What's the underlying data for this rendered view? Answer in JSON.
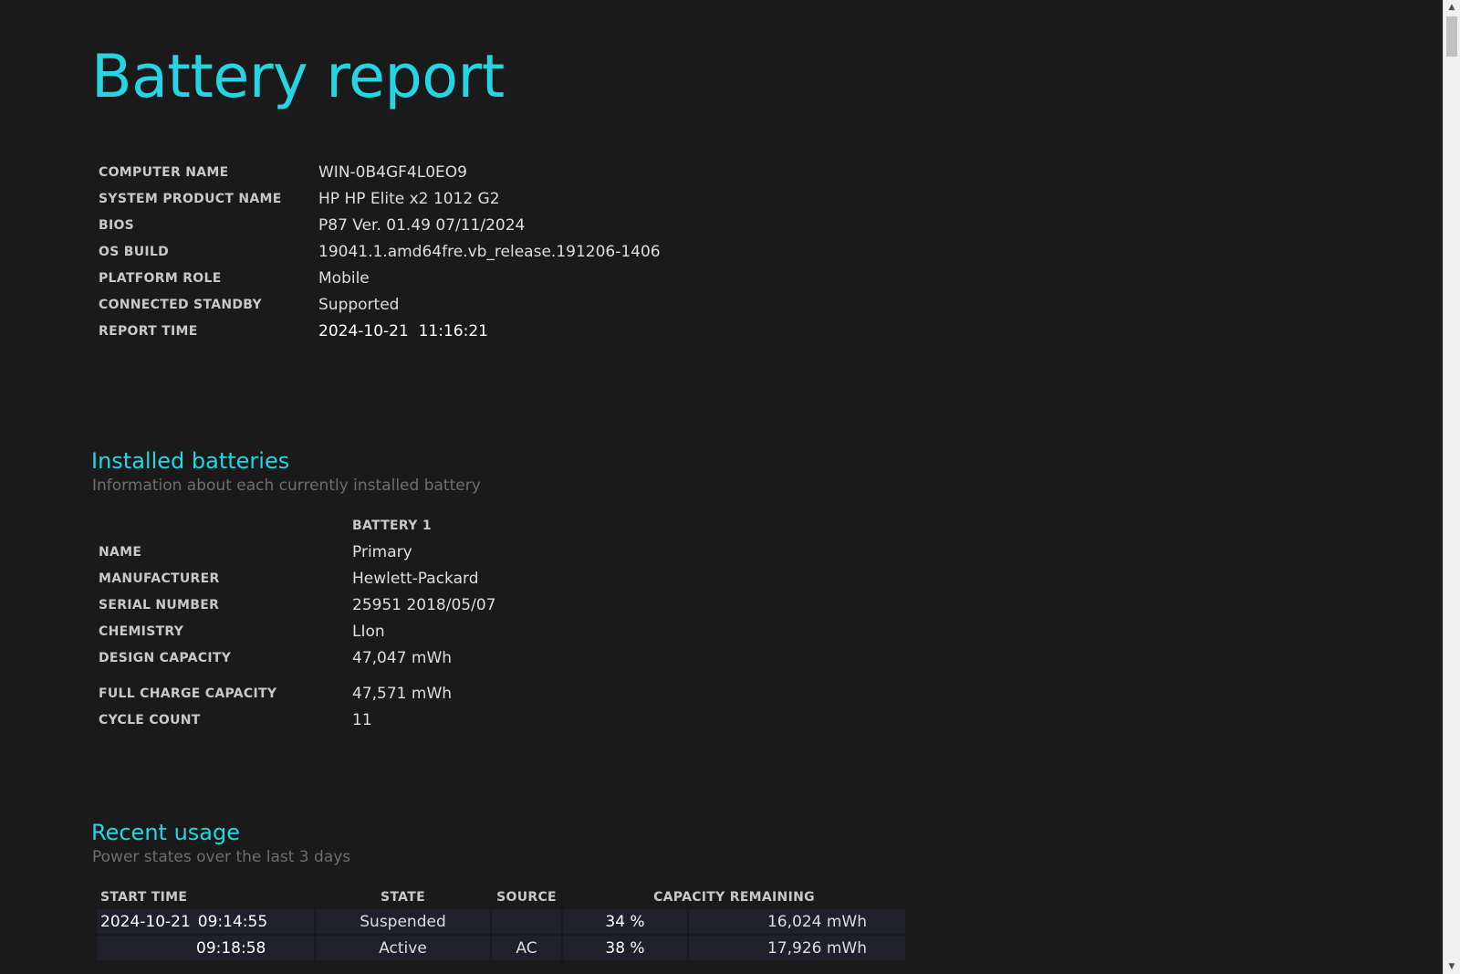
{
  "report": {
    "title": "Battery report"
  },
  "system_info": [
    {
      "label": "COMPUTER NAME",
      "value": "WIN-0B4GF4L0EO9"
    },
    {
      "label": "SYSTEM PRODUCT NAME",
      "value": "HP HP Elite x2 1012 G2"
    },
    {
      "label": "BIOS",
      "value": "P87 Ver. 01.49 07/11/2024"
    },
    {
      "label": "OS BUILD",
      "value": "19041.1.amd64fre.vb_release.191206-1406"
    },
    {
      "label": "PLATFORM ROLE",
      "value": "Mobile"
    },
    {
      "label": "CONNECTED STANDBY",
      "value": "Supported"
    },
    {
      "label": "REPORT TIME",
      "value": "2024-10-21  11:16:21"
    }
  ],
  "installed_batteries": {
    "title": "Installed batteries",
    "subtitle": "Information about each currently installed battery",
    "column_header": "BATTERY 1",
    "rows": [
      {
        "label": "NAME",
        "value": "Primary"
      },
      {
        "label": "MANUFACTURER",
        "value": "Hewlett-Packard"
      },
      {
        "label": "SERIAL NUMBER",
        "value": "25951 2018/05/07"
      },
      {
        "label": "CHEMISTRY",
        "value": "LIon"
      },
      {
        "label": "DESIGN CAPACITY",
        "value": "47,047 mWh"
      },
      {
        "label": "FULL CHARGE CAPACITY",
        "value": "47,571 mWh"
      },
      {
        "label": "CYCLE COUNT",
        "value": "11"
      }
    ]
  },
  "recent_usage": {
    "title": "Recent usage",
    "subtitle": "Power states over the last 3 days",
    "headers": {
      "start_time": "START TIME",
      "state": "STATE",
      "source": "SOURCE",
      "capacity_remaining": "CAPACITY REMAINING"
    },
    "rows": [
      {
        "date": "2024-10-21",
        "time": "09:14:55",
        "state": "Suspended",
        "source": "",
        "percent": "34 %",
        "mwh": "16,024 mWh"
      },
      {
        "date": "",
        "time": "09:18:58",
        "state": "Active",
        "source": "AC",
        "percent": "38 %",
        "mwh": "17,926 mWh"
      }
    ]
  }
}
